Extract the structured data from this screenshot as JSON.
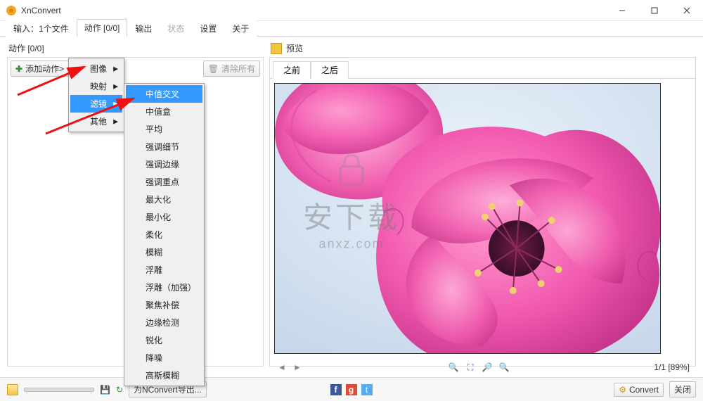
{
  "window": {
    "title": "XnConvert"
  },
  "tabs": {
    "input": "输入：1个文件",
    "actions": "动作 [0/0]",
    "output": "输出",
    "status": "状态",
    "settings": "设置",
    "about": "关于"
  },
  "left": {
    "group_label": "动作 [0/0]",
    "add_action": "添加动作>",
    "clear_all": "清除所有"
  },
  "menu1": {
    "image": "图像",
    "map": "映射",
    "filter": "滤镜",
    "other": "其他"
  },
  "menu2": {
    "items": [
      "中值交叉",
      "中值盒",
      "平均",
      "强调细节",
      "强调边缘",
      "强调重点",
      "最大化",
      "最小化",
      "柔化",
      "模糊",
      "浮雕",
      "浮雕（加强）",
      "聚焦补偿",
      "边缘检测",
      "锐化",
      "降噪",
      "高斯模糊"
    ]
  },
  "preview": {
    "label": "预览",
    "before": "之前",
    "after": "之后",
    "counter": "1/1 [89%]"
  },
  "bottom": {
    "export": "为NConvert导出...",
    "convert": "Convert",
    "close": "关闭"
  },
  "watermark": {
    "line1": "安下载",
    "line2": "anxz.com"
  }
}
